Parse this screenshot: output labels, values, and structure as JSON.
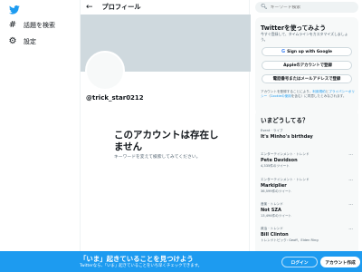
{
  "nav": {
    "items": [
      {
        "label": "話題を検索"
      },
      {
        "label": "設定"
      }
    ]
  },
  "header": {
    "title": "プロフィール"
  },
  "profile": {
    "handle": "@trick_star0212",
    "not_exist_title": "このアカウントは存在しません",
    "not_exist_sub": "キーワードを変えて検索してみてください。"
  },
  "search": {
    "placeholder": "キーワード検索"
  },
  "signup": {
    "title": "Twitterを使ってみよう",
    "desc": "今すぐ登録して、タイムラインをカスタマイズしましょう。",
    "google": "Sign up with Google",
    "apple": "Appleのアカウントで登録",
    "phone": "電話番号またはメールアドレスで登録",
    "terms_pre": "アカウントを登録することにより、",
    "terms_link1": "利用規約",
    "terms_mid1": "と",
    "terms_link2": "プライバシーポリシー",
    "terms_mid2": "（",
    "terms_link3": "Cookieの使用",
    "terms_post": "を含む）に同意したとみなされます。"
  },
  "trends": {
    "title": "いまどうしてる？",
    "items": [
      {
        "category": "Event · ライブ",
        "name": "It's Minho's birthday",
        "count": ""
      },
      {
        "category": "エンターテインメント · トレンド",
        "name": "Pete Davidson",
        "count": "4,335件のツイート"
      },
      {
        "category": "エンターテインメント · トレンド",
        "name": "Markiplier",
        "count": "36,599件のツイート"
      },
      {
        "category": "音楽 · トレンド",
        "name": "Not SZA",
        "count": "13,494件のツイート"
      },
      {
        "category": "政治 · トレンド",
        "name": "Bill Clinton",
        "count": "トレンドトピック: Geoff、Elden Ring"
      }
    ]
  },
  "bottom": {
    "title": "「いま」起きていることを見つけよう",
    "sub": "Twitterなら、「いま」起きていることをいち早くチェックできます。",
    "login": "ログイン",
    "signup": "アカウント作成"
  },
  "colors": {
    "accent": "#1d9bf0",
    "banner": "#cfd9de",
    "card": "#f7f9f9"
  }
}
